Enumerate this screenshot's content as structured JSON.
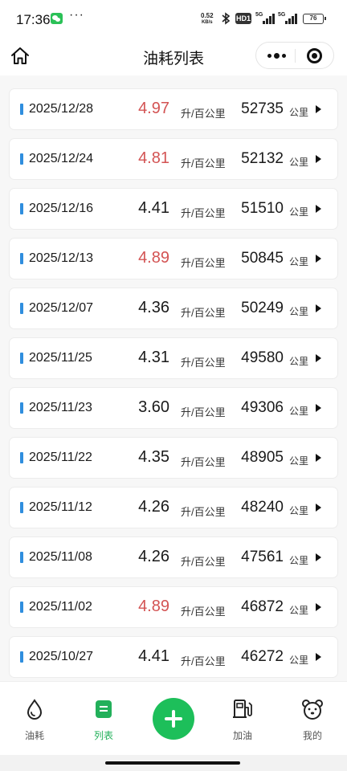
{
  "status_bar": {
    "time": "17:36",
    "more": "···",
    "net_speed_value": "0.52",
    "net_speed_unit": "KB/s",
    "hd_label": "HD1",
    "signal_1_label": "5G",
    "signal_2_label": "5G",
    "battery_level": "76"
  },
  "header": {
    "title": "油耗列表"
  },
  "records": [
    {
      "date": "2025/12/28",
      "consumption": "4.97",
      "consumption_unit": "升/百公里",
      "odometer": "52735",
      "odometer_unit": "公里",
      "highlight": true
    },
    {
      "date": "2025/12/24",
      "consumption": "4.81",
      "consumption_unit": "升/百公里",
      "odometer": "52132",
      "odometer_unit": "公里",
      "highlight": true
    },
    {
      "date": "2025/12/16",
      "consumption": "4.41",
      "consumption_unit": "升/百公里",
      "odometer": "51510",
      "odometer_unit": "公里",
      "highlight": false
    },
    {
      "date": "2025/12/13",
      "consumption": "4.89",
      "consumption_unit": "升/百公里",
      "odometer": "50845",
      "odometer_unit": "公里",
      "highlight": true
    },
    {
      "date": "2025/12/07",
      "consumption": "4.36",
      "consumption_unit": "升/百公里",
      "odometer": "50249",
      "odometer_unit": "公里",
      "highlight": false
    },
    {
      "date": "2025/11/25",
      "consumption": "4.31",
      "consumption_unit": "升/百公里",
      "odometer": "49580",
      "odometer_unit": "公里",
      "highlight": false
    },
    {
      "date": "2025/11/23",
      "consumption": "3.60",
      "consumption_unit": "升/百公里",
      "odometer": "49306",
      "odometer_unit": "公里",
      "highlight": false
    },
    {
      "date": "2025/11/22",
      "consumption": "4.35",
      "consumption_unit": "升/百公里",
      "odometer": "48905",
      "odometer_unit": "公里",
      "highlight": false
    },
    {
      "date": "2025/11/12",
      "consumption": "4.26",
      "consumption_unit": "升/百公里",
      "odometer": "48240",
      "odometer_unit": "公里",
      "highlight": false
    },
    {
      "date": "2025/11/08",
      "consumption": "4.26",
      "consumption_unit": "升/百公里",
      "odometer": "47561",
      "odometer_unit": "公里",
      "highlight": false
    },
    {
      "date": "2025/11/02",
      "consumption": "4.89",
      "consumption_unit": "升/百公里",
      "odometer": "46872",
      "odometer_unit": "公里",
      "highlight": true
    },
    {
      "date": "2025/10/27",
      "consumption": "4.41",
      "consumption_unit": "升/百公里",
      "odometer": "46272",
      "odometer_unit": "公里",
      "highlight": false
    }
  ],
  "tabs": [
    {
      "label": "油耗",
      "icon": "drop-icon",
      "active": false
    },
    {
      "label": "列表",
      "icon": "list-icon",
      "active": true
    },
    {
      "label": "加油",
      "icon": "fuel-pump-icon",
      "active": false
    },
    {
      "label": "我的",
      "icon": "bear-face-icon",
      "active": false
    }
  ],
  "colors": {
    "accent_green": "#1dbf5a",
    "high_consumption_red": "#d35353",
    "row_marker_blue": "#2f8ede"
  }
}
